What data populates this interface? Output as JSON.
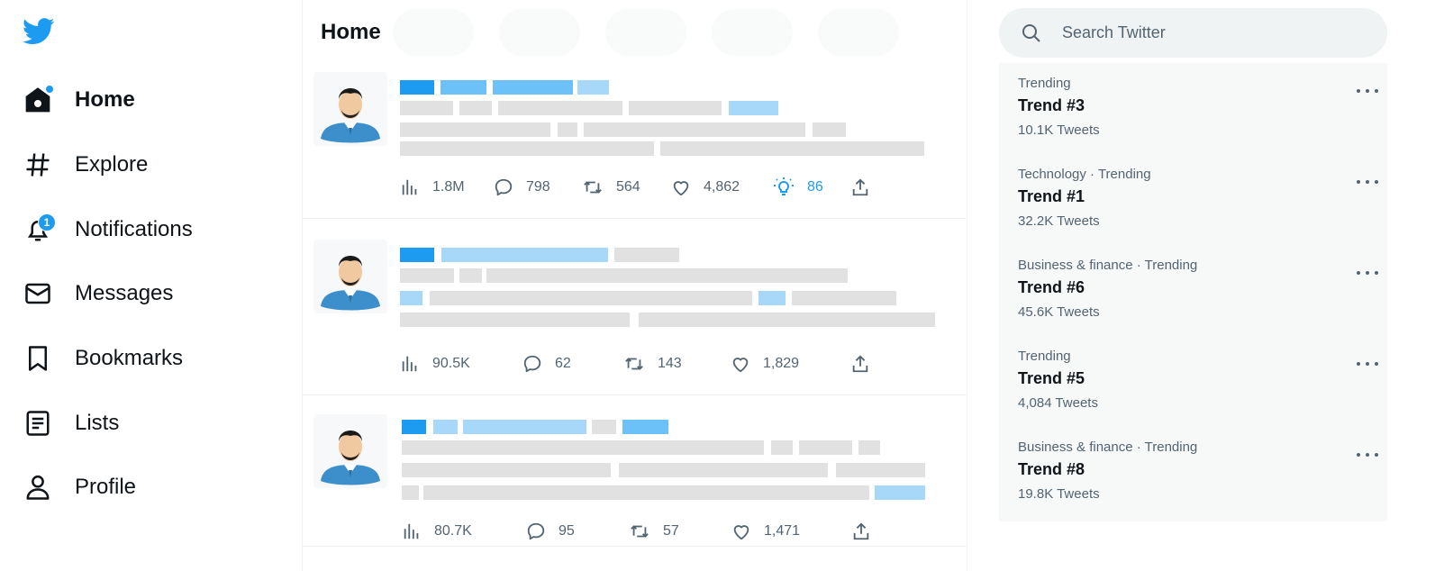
{
  "nav": {
    "items": [
      {
        "label": "Home",
        "icon": "home-icon",
        "active": true
      },
      {
        "label": "Explore",
        "icon": "hash-icon"
      },
      {
        "label": "Notifications",
        "icon": "bell-icon",
        "badge": "1"
      },
      {
        "label": "Messages",
        "icon": "envelope-icon"
      },
      {
        "label": "Bookmarks",
        "icon": "bookmark-icon"
      },
      {
        "label": "Lists",
        "icon": "list-icon"
      },
      {
        "label": "Profile",
        "icon": "person-icon"
      }
    ]
  },
  "main": {
    "title": "Home",
    "tweets": [
      {
        "views": "1.8M",
        "replies": "798",
        "retweets": "564",
        "likes": "4,862",
        "insights": "86"
      },
      {
        "views": "90.5K",
        "replies": "62",
        "retweets": "143",
        "likes": "1,829"
      },
      {
        "views": "80.7K",
        "replies": "95",
        "retweets": "57",
        "likes": "1,471"
      }
    ]
  },
  "search": {
    "placeholder": "Search Twitter"
  },
  "trends": [
    {
      "category": "Trending",
      "name": "Trend #3",
      "count": "10.1K Tweets"
    },
    {
      "category": "Technology · Trending",
      "name": "Trend #1",
      "count": "32.2K Tweets"
    },
    {
      "category": "Business & finance · Trending",
      "name": "Trend #6",
      "count": "45.6K Tweets"
    },
    {
      "category": "Trending",
      "name": "Trend #5",
      "count": "4,084 Tweets"
    },
    {
      "category": "Business & finance · Trending",
      "name": "Trend #8",
      "count": "19.8K Tweets"
    }
  ],
  "colors": {
    "accent": "#1d9bf0",
    "text": "#0f1419",
    "muted": "#536471"
  }
}
